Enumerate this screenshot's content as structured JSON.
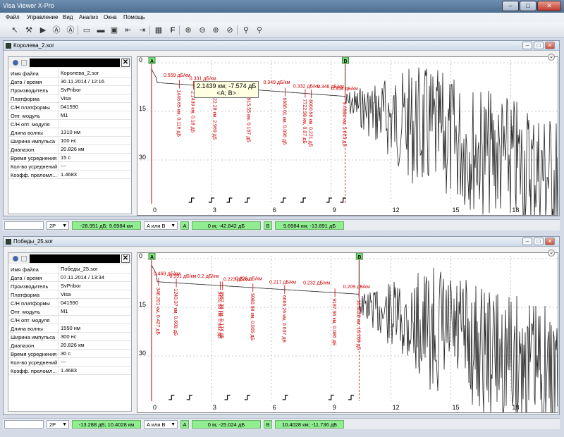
{
  "app": {
    "title": "Visa Viewer X-Pro"
  },
  "window_controls": {
    "minimize": "–",
    "maximize": "□",
    "close": "✕"
  },
  "menu": [
    {
      "label": "Файл"
    },
    {
      "label": "Управление"
    },
    {
      "label": "Вид"
    },
    {
      "label": "Анализ"
    },
    {
      "label": "Окна"
    },
    {
      "label": "Помощь"
    }
  ],
  "toolbar": {
    "icons": [
      "pointer-icon",
      "wrench-icon",
      "play-icon",
      "a-circle-icon",
      "a-outline-icon",
      "open-folder-icon",
      "folder-icon",
      "save-icon",
      "import-icon",
      "export-icon",
      "grid-icon",
      "f-icon",
      "zoom-in-icon",
      "zoom-out-icon",
      "zoom-fit-icon",
      "zoom-reset-icon",
      "search-icon",
      "search-alt-icon"
    ],
    "f_label": "F"
  },
  "docs": [
    {
      "title": "Королева_2.sor",
      "props": [
        {
          "k": "Имя файла",
          "v": "Королева_2.sor"
        },
        {
          "k": "Дата / время",
          "v": "30.11.2014 / 12:16"
        },
        {
          "k": "Производитель",
          "v": "SvPribor"
        },
        {
          "k": "Платформа",
          "v": "Visa"
        },
        {
          "k": "С/Н платформы",
          "v": "041590"
        },
        {
          "k": "Опт. модуль",
          "v": "M1"
        },
        {
          "k": "С/Н опт. модуля",
          "v": ""
        },
        {
          "k": "Длина волны",
          "v": "1310 нм"
        },
        {
          "k": "Ширина импульса",
          "v": "100 нс"
        },
        {
          "k": "Диапазон",
          "v": "20.826 км"
        },
        {
          "k": "Время усреднения",
          "v": "15 с"
        },
        {
          "k": "Кол-во усреднений",
          "v": "---"
        },
        {
          "k": "Коэфф. преломл...",
          "v": "1.4683"
        }
      ],
      "plot": {
        "y_ticks": [
          "0",
          "15",
          "30"
        ],
        "x_ticks": [
          "0",
          "3",
          "6",
          "9",
          "12",
          "15",
          "18"
        ],
        "marker_a": "A",
        "marker_b": "B",
        "atten_labels": [
          "0.559 дБ/км",
          "0.331 дБ/км",
          "0.349 дБ/км",
          "0.332 дБ/км",
          "0.346 дБ/км",
          "0.358 дБ/км"
        ],
        "event_labels": [
          "1446.65 км, 0.116 дБ",
          "2.1439 км, 0.18 дБ",
          "3222.28 км, 2.969 дБ",
          "4915.55 км, 0.167 дБ",
          "6686.01 км, 0.096 дБ",
          "7722.98 км, 0.07 дБ",
          "8000.96 км, 0.221 дБ",
          "9.6984 км, 5.625 дБ"
        ],
        "tooltip_line1": "2.1439 км; -7.574 дБ",
        "tooltip_line2": "<A; B>"
      },
      "status": {
        "mode": "2P",
        "loss_dist": "-28.951 дБ; 9.6984 км",
        "marker_mode": "A или B",
        "a_label": "A",
        "a_value": "0 м; -42.842 дБ",
        "b_label": "B",
        "b_value": "9.6984 км; -13.891 дБ"
      }
    },
    {
      "title": "Победы_25.sor",
      "props": [
        {
          "k": "Имя файла",
          "v": "Победы_25.sor"
        },
        {
          "k": "Дата / время",
          "v": "07.11.2014 / 13:34"
        },
        {
          "k": "Производитель",
          "v": "SvPribor"
        },
        {
          "k": "Платформа",
          "v": "Visa"
        },
        {
          "k": "С/Н платформы",
          "v": "041590"
        },
        {
          "k": "Опт. модуль",
          "v": "M1"
        },
        {
          "k": "С/Н опт. модуля",
          "v": ""
        },
        {
          "k": "Длина волны",
          "v": "1550 нм"
        },
        {
          "k": "Ширина импульса",
          "v": "300 нс"
        },
        {
          "k": "Диапазон",
          "v": "20.826 км"
        },
        {
          "k": "Время усреднения",
          "v": "30 с"
        },
        {
          "k": "Кол-во усреднений",
          "v": "---"
        },
        {
          "k": "Коэфф. преломл...",
          "v": "1.4683"
        }
      ],
      "plot": {
        "y_ticks": [
          "0",
          "15",
          "30"
        ],
        "x_ticks": [
          "0",
          "3",
          "6",
          "9",
          "12",
          "15",
          "18"
        ],
        "marker_a": "A",
        "marker_b": "B",
        "atten_labels": [
          "0.468 дБ/км",
          "0.551 дБ/км",
          "0.2 дБ/км",
          "0.223 дБ/км",
          "0.226 дБ/км",
          "0.217 дБ/км",
          "0.232 дБ/км",
          "0.209 дБ/км"
        ],
        "event_labels": [
          "346.201 км, 0.427 дБ",
          "1240.37 км, 0.608 дБ",
          "3451.68 км, 0.442 дБ",
          "3557.38 км, 0.174 дБ",
          "5080.98 км, 0.005 дБ",
          "6666.26 км, 0.637 дБ",
          "9187.96 км, 0.086 дБ",
          "10.4028 км, 18.209 дБ"
        ]
      },
      "status": {
        "mode": "2P",
        "loss_dist": "-13.288 дБ; 10.4028 км",
        "marker_mode": "A или B",
        "a_label": "A",
        "a_value": "0 м; -25.024 дБ",
        "b_label": "B",
        "b_value": "10.4028 км; -11.736 дБ"
      }
    }
  ]
}
